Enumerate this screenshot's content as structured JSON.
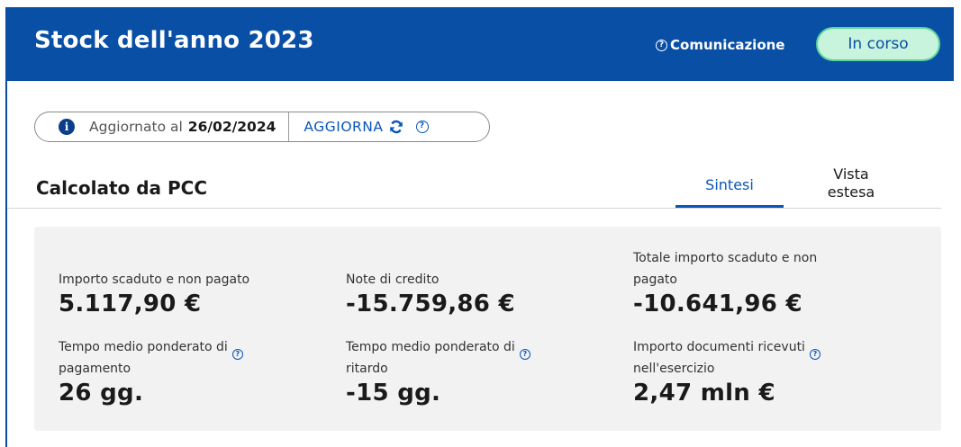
{
  "header": {
    "title": "Stock dell'anno 2023",
    "communication_label": "Comunicazione",
    "status_label": "In corso",
    "brand_color": "#0a4fa6",
    "status_color": "#c8f3dc"
  },
  "update_bar": {
    "info_icon": "info-icon",
    "updated_label": "Aggiornato al",
    "updated_date": "26/02/2024",
    "refresh_label": "AGGIORNA",
    "refresh_icon": "refresh-icon",
    "help_icon": "question-icon"
  },
  "section": {
    "title": "Calcolato da PCC",
    "tabs": [
      {
        "label": "Sintesi",
        "active": true
      },
      {
        "label_line1": "Vista",
        "label_line2": "estesa",
        "active": false
      }
    ]
  },
  "stats": {
    "unpaid_overdue": {
      "label": "Importo scaduto e non pagato",
      "value": "5.117,90 €"
    },
    "credit_notes": {
      "label": "Note di credito",
      "value": "-15.759,86 €"
    },
    "total_overdue": {
      "label_line1": "Totale importo scaduto e non",
      "label_line2": "pagato",
      "value": "-10.641,96 €"
    },
    "avg_payment_time": {
      "label_line1": "Tempo medio ponderato di",
      "label_line2": "pagamento",
      "value": "26 gg."
    },
    "avg_delay_time": {
      "label_line1": "Tempo medio ponderato di",
      "label_line2": "ritardo",
      "value": "-15 gg."
    },
    "received_docs": {
      "label_line1": "Importo documenti ricevuti",
      "label_line2": "nell'esercizio",
      "value": "2,47 mln €"
    }
  }
}
